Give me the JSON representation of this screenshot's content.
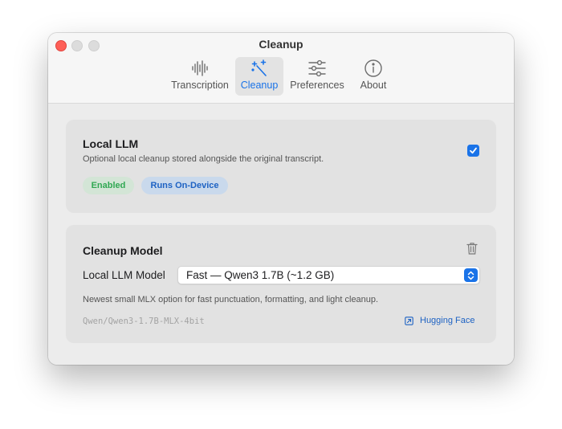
{
  "window": {
    "title": "Cleanup"
  },
  "tabs": [
    {
      "label": "Transcription",
      "icon": "waveform-icon",
      "active": false
    },
    {
      "label": "Cleanup",
      "icon": "magic-wand-icon",
      "active": true
    },
    {
      "label": "Preferences",
      "icon": "sliders-icon",
      "active": false
    },
    {
      "label": "About",
      "icon": "info-icon",
      "active": false
    }
  ],
  "local_llm": {
    "title": "Local LLM",
    "description": "Optional local cleanup stored alongside the original transcript.",
    "checked": true,
    "badges": [
      {
        "label": "Enabled",
        "color": "#31a853"
      },
      {
        "label": "Runs On-Device",
        "color": "#1d62c3"
      }
    ]
  },
  "cleanup_model": {
    "title": "Cleanup Model",
    "field_label": "Local LLM Model",
    "selected_value": "Fast — Qwen3 1.7B (~1.2 GB)",
    "description": "Newest small MLX option for fast punctuation, formatting, and light cleanup.",
    "model_id": "Qwen/Qwen3-1.7B-MLX-4bit",
    "link_label": "Hugging Face"
  },
  "colors": {
    "accent": "#1a73e8",
    "close": "#fe5f57"
  }
}
